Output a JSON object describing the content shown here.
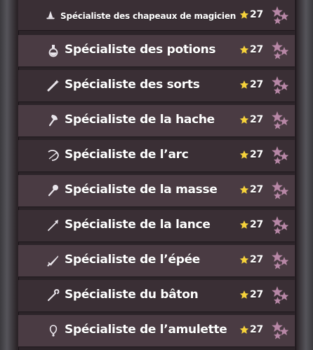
{
  "achievements": [
    {
      "title": "Spécialiste des chapeaux de magicien",
      "points": "27",
      "icon": "wizard-hat-icon"
    },
    {
      "title": "Spécialiste des potions",
      "points": "27",
      "icon": "potion-icon"
    },
    {
      "title": "Spécialiste des sorts",
      "points": "27",
      "icon": "wand-icon"
    },
    {
      "title": "Spécialiste de la hache",
      "points": "27",
      "icon": "axe-icon"
    },
    {
      "title": "Spécialiste de l’arc",
      "points": "27",
      "icon": "bow-icon"
    },
    {
      "title": "Spécialiste de la masse",
      "points": "27",
      "icon": "mace-icon"
    },
    {
      "title": "Spécialiste de la lance",
      "points": "27",
      "icon": "spear-icon"
    },
    {
      "title": "Spécialiste de l’épée",
      "points": "27",
      "icon": "sword-icon"
    },
    {
      "title": "Spécialiste du bâton",
      "points": "27",
      "icon": "staff-icon"
    },
    {
      "title": "Spécialiste de l’amulette",
      "points": "27",
      "icon": "amulet-icon"
    }
  ],
  "colors": {
    "star_gold": "#f6d23a",
    "star_pink": "#b787a6",
    "row_light": "#4a3b43",
    "row_dark": "#3a2f35"
  }
}
